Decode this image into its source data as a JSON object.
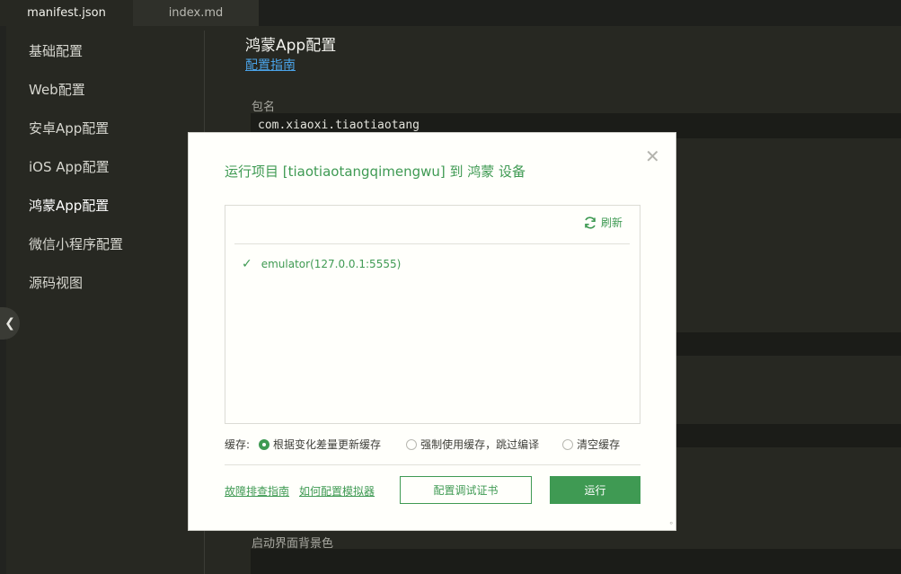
{
  "tabs": [
    {
      "label": "manifest.json",
      "active": true
    },
    {
      "label": "index.md",
      "active": false
    }
  ],
  "sidebar": {
    "items": [
      {
        "label": "基础配置"
      },
      {
        "label": "Web配置"
      },
      {
        "label": "安卓App配置"
      },
      {
        "label": "iOS App配置"
      },
      {
        "label": "鸿蒙App配置",
        "selected": true
      },
      {
        "label": "微信小程序配置"
      },
      {
        "label": "源码视图"
      }
    ]
  },
  "main": {
    "title": "鸿蒙App配置",
    "guide_link": "配置指南",
    "package_label": "包名",
    "package_value": "com.xiaoxi.tiaotiaotang",
    "splash_bg_label": "启动界面背景色"
  },
  "dialog": {
    "title": "运行项目 [tiaotiaotangqimengwu] 到 鸿蒙 设备",
    "refresh_label": "刷新",
    "devices": [
      {
        "label": "emulator(127.0.0.1:5555)",
        "selected": true
      }
    ],
    "cache_label": "缓存:",
    "cache_options": [
      {
        "label": "根据变化差量更新缓存",
        "selected": true
      },
      {
        "label": "强制使用缓存，跳过编译",
        "selected": false
      },
      {
        "label": "清空缓存",
        "selected": false
      }
    ],
    "troubleshoot_link": "故障排查指南",
    "emulator_link": "如何配置模拟器",
    "cert_button": "配置调试证书",
    "run_button": "运行"
  },
  "colors": {
    "accent_green": "#3f9a53",
    "editor_bg": "#272822",
    "link_blue": "#4aa3e8"
  }
}
